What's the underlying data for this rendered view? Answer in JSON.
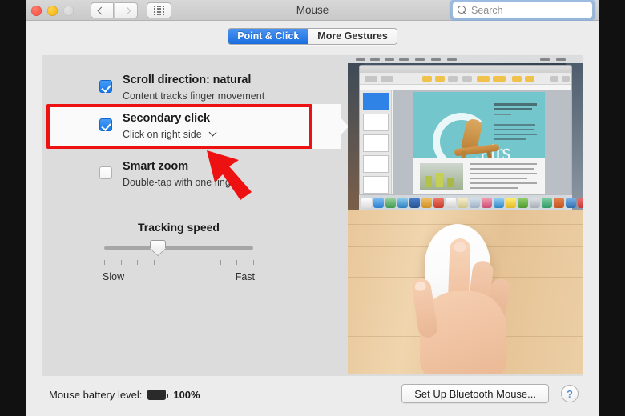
{
  "window": {
    "title": "Mouse",
    "traffic_lights": [
      "close",
      "minimize",
      "zoom-disabled"
    ],
    "nav": {
      "back_icon": "chevron-left-icon",
      "forward_icon": "chevron-right-icon"
    },
    "show_all_icon": "grid-icon"
  },
  "search": {
    "placeholder": "Search",
    "value": "",
    "icon": "search-icon",
    "focused": true
  },
  "tabs": [
    {
      "label": "Point & Click",
      "active": true
    },
    {
      "label": "More Gestures",
      "active": false
    }
  ],
  "options": [
    {
      "name": "scroll-direction",
      "title": "Scroll direction: natural",
      "subtitle": "Content tracks finger movement",
      "checked": true,
      "has_dropdown": false,
      "highlighted": false
    },
    {
      "name": "secondary-click",
      "title": "Secondary click",
      "subtitle": "Click on right side",
      "checked": true,
      "has_dropdown": true,
      "dropdown_icon": "chevron-down-icon",
      "highlighted": true
    },
    {
      "name": "smart-zoom",
      "title": "Smart zoom",
      "subtitle": "Double-tap with one finger",
      "checked": false,
      "has_dropdown": false,
      "highlighted": false
    }
  ],
  "slider": {
    "label": "Tracking speed",
    "min_label": "Slow",
    "max_label": "Fast",
    "value_percent": 36,
    "tick_count": 10
  },
  "preview": {
    "type": "video-preview",
    "top_scene": "pages-document-screen-recording",
    "bottom_scene": "hand-on-magic-mouse",
    "document_word": "airs"
  },
  "footer": {
    "battery_label": "Mouse battery level:",
    "battery_icon": "battery-full-icon",
    "battery_percent": "100%",
    "setup_button": "Set Up Bluetooth Mouse...",
    "help_button": "?"
  },
  "annotations": {
    "highlight_color": "#ee1111",
    "box_target": "secondary-click",
    "arrow_target": "secondary-click"
  },
  "colors": {
    "accent_blue": "#1a6ee0",
    "checkbox_blue": "#1479ec",
    "panel_bg": "#dcdcdc",
    "chrome_bg": "#ececec",
    "annotation_red": "#ee1111"
  }
}
